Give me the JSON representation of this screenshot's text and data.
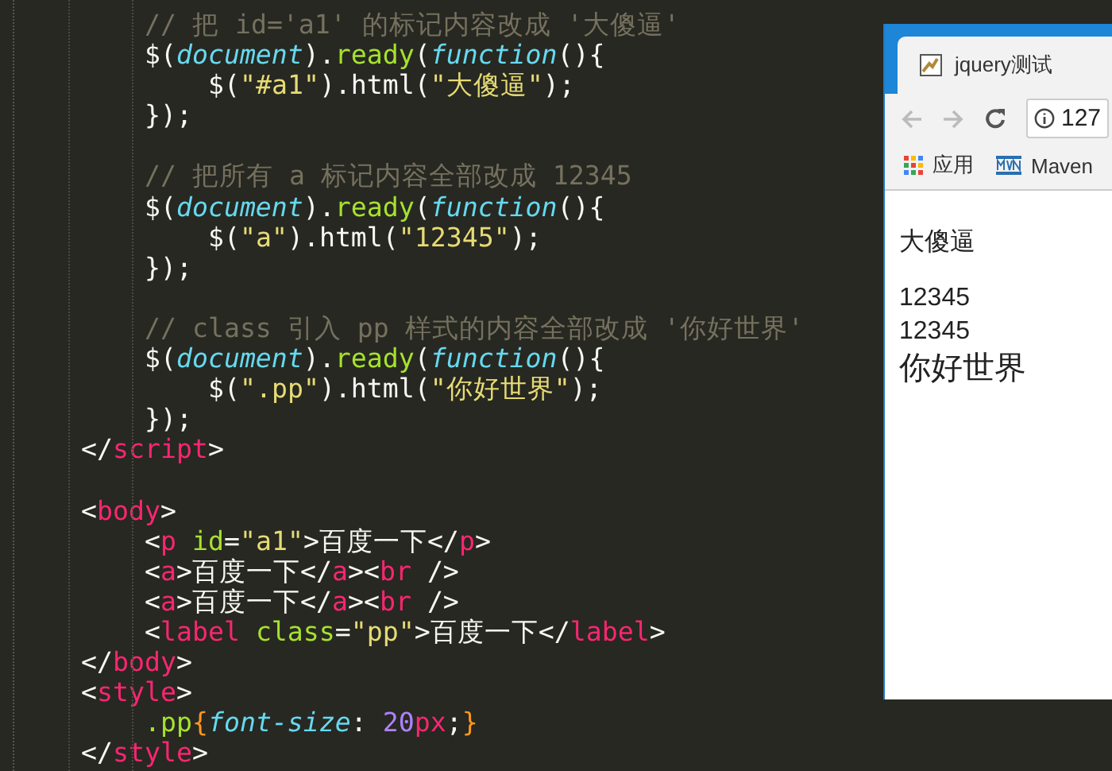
{
  "editor": {
    "lines": [
      {
        "kind": "inner",
        "tokens": [
          {
            "kind": "comment",
            "text": "// 把 id='a1' 的标记内容改成 '大傻逼'"
          }
        ]
      },
      {
        "kind": "inner",
        "tokens": [
          {
            "kind": "plain",
            "text": "$("
          },
          {
            "kind": "keyword",
            "text": "document"
          },
          {
            "kind": "plain",
            "text": ")."
          },
          {
            "kind": "func",
            "text": "ready"
          },
          {
            "kind": "plain",
            "text": "("
          },
          {
            "kind": "keyword",
            "text": "function"
          },
          {
            "kind": "plain",
            "text": "(){"
          }
        ]
      },
      {
        "kind": "deep",
        "tokens": [
          {
            "kind": "plain",
            "text": "$("
          },
          {
            "kind": "string",
            "text": "\"#a1\""
          },
          {
            "kind": "plain",
            "text": ").html("
          },
          {
            "kind": "string",
            "text": "\"大傻逼\""
          },
          {
            "kind": "plain",
            "text": ");"
          }
        ]
      },
      {
        "kind": "inner",
        "tokens": [
          {
            "kind": "plain",
            "text": "});"
          }
        ]
      },
      {
        "kind": "blank"
      },
      {
        "kind": "inner",
        "tokens": [
          {
            "kind": "comment",
            "text": "// 把所有 a 标记内容全部改成 12345"
          }
        ]
      },
      {
        "kind": "inner",
        "tokens": [
          {
            "kind": "plain",
            "text": "$("
          },
          {
            "kind": "keyword",
            "text": "document"
          },
          {
            "kind": "plain",
            "text": ")."
          },
          {
            "kind": "func",
            "text": "ready"
          },
          {
            "kind": "plain",
            "text": "("
          },
          {
            "kind": "keyword",
            "text": "function"
          },
          {
            "kind": "plain",
            "text": "(){"
          }
        ]
      },
      {
        "kind": "deep",
        "tokens": [
          {
            "kind": "plain",
            "text": "$("
          },
          {
            "kind": "string",
            "text": "\"a\""
          },
          {
            "kind": "plain",
            "text": ").html("
          },
          {
            "kind": "string",
            "text": "\"12345\""
          },
          {
            "kind": "plain",
            "text": ");"
          }
        ]
      },
      {
        "kind": "inner",
        "tokens": [
          {
            "kind": "plain",
            "text": "});"
          }
        ]
      },
      {
        "kind": "blank"
      },
      {
        "kind": "inner",
        "tokens": [
          {
            "kind": "comment",
            "text": "// class 引入 pp 样式的内容全部改成 '你好世界'"
          }
        ]
      },
      {
        "kind": "inner",
        "tokens": [
          {
            "kind": "plain",
            "text": "$("
          },
          {
            "kind": "keyword",
            "text": "document"
          },
          {
            "kind": "plain",
            "text": ")."
          },
          {
            "kind": "func",
            "text": "ready"
          },
          {
            "kind": "plain",
            "text": "("
          },
          {
            "kind": "keyword",
            "text": "function"
          },
          {
            "kind": "plain",
            "text": "(){"
          }
        ]
      },
      {
        "kind": "deep",
        "tokens": [
          {
            "kind": "plain",
            "text": "$("
          },
          {
            "kind": "string",
            "text": "\".pp\""
          },
          {
            "kind": "plain",
            "text": ").html("
          },
          {
            "kind": "string",
            "text": "\"你好世界\""
          },
          {
            "kind": "plain",
            "text": ");"
          }
        ]
      },
      {
        "kind": "inner",
        "tokens": [
          {
            "kind": "plain",
            "text": "});"
          }
        ]
      },
      {
        "kind": "outer",
        "tokens": [
          {
            "kind": "plain",
            "text": "</"
          },
          {
            "kind": "tag",
            "text": "script"
          },
          {
            "kind": "plain",
            "text": ">"
          }
        ]
      },
      {
        "kind": "blank"
      },
      {
        "kind": "outer",
        "tokens": [
          {
            "kind": "plain",
            "text": "<"
          },
          {
            "kind": "tag",
            "text": "body"
          },
          {
            "kind": "plain",
            "text": ">"
          }
        ]
      },
      {
        "kind": "inner",
        "tokens": [
          {
            "kind": "plain",
            "text": "<"
          },
          {
            "kind": "tag",
            "text": "p"
          },
          {
            "kind": "attr",
            "text": " id"
          },
          {
            "kind": "plain",
            "text": "="
          },
          {
            "kind": "string",
            "text": "\"a1\""
          },
          {
            "kind": "plain",
            "text": ">百度一下</"
          },
          {
            "kind": "tag",
            "text": "p"
          },
          {
            "kind": "plain",
            "text": ">"
          }
        ]
      },
      {
        "kind": "inner",
        "tokens": [
          {
            "kind": "plain",
            "text": "<"
          },
          {
            "kind": "tag",
            "text": "a"
          },
          {
            "kind": "plain",
            "text": ">百度一下</"
          },
          {
            "kind": "tag",
            "text": "a"
          },
          {
            "kind": "plain",
            "text": "><"
          },
          {
            "kind": "tag",
            "text": "br"
          },
          {
            "kind": "plain",
            "text": " />"
          }
        ]
      },
      {
        "kind": "inner",
        "tokens": [
          {
            "kind": "plain",
            "text": "<"
          },
          {
            "kind": "tag",
            "text": "a"
          },
          {
            "kind": "plain",
            "text": ">百度一下</"
          },
          {
            "kind": "tag",
            "text": "a"
          },
          {
            "kind": "plain",
            "text": "><"
          },
          {
            "kind": "tag",
            "text": "br"
          },
          {
            "kind": "plain",
            "text": " />"
          }
        ]
      },
      {
        "kind": "inner",
        "tokens": [
          {
            "kind": "plain",
            "text": "<"
          },
          {
            "kind": "tag",
            "text": "label"
          },
          {
            "kind": "attr",
            "text": " class"
          },
          {
            "kind": "plain",
            "text": "="
          },
          {
            "kind": "string",
            "text": "\"pp\""
          },
          {
            "kind": "plain",
            "text": ">百度一下</"
          },
          {
            "kind": "tag",
            "text": "label"
          },
          {
            "kind": "plain",
            "text": ">"
          }
        ]
      },
      {
        "kind": "outer",
        "tokens": [
          {
            "kind": "plain",
            "text": "</"
          },
          {
            "kind": "tag",
            "text": "body"
          },
          {
            "kind": "plain",
            "text": ">"
          }
        ]
      },
      {
        "kind": "outer",
        "tokens": [
          {
            "kind": "plain",
            "text": "<"
          },
          {
            "kind": "tag",
            "text": "style"
          },
          {
            "kind": "plain",
            "text": ">"
          }
        ]
      },
      {
        "kind": "inner",
        "tokens": [
          {
            "kind": "func",
            "text": ".pp"
          },
          {
            "kind": "brace",
            "text": "{"
          },
          {
            "kind": "keyword",
            "text": "font-size"
          },
          {
            "kind": "plain",
            "text": ": "
          },
          {
            "kind": "number",
            "text": "20"
          },
          {
            "kind": "tag",
            "text": "px"
          },
          {
            "kind": "plain",
            "text": ";"
          },
          {
            "kind": "brace",
            "text": "}"
          }
        ]
      },
      {
        "kind": "outer",
        "tokens": [
          {
            "kind": "plain",
            "text": "</"
          },
          {
            "kind": "tag",
            "text": "style"
          },
          {
            "kind": "plain",
            "text": ">"
          }
        ]
      }
    ]
  },
  "browser": {
    "tab_title": "jquery测试",
    "address": "127",
    "bookmarks": [
      "应用",
      "Maven"
    ],
    "content": [
      {
        "kind": "para",
        "text": "大傻逼"
      },
      {
        "kind": "line",
        "text": "12345"
      },
      {
        "kind": "line",
        "text": "12345"
      },
      {
        "kind": "large",
        "text": "你好世界"
      }
    ]
  }
}
